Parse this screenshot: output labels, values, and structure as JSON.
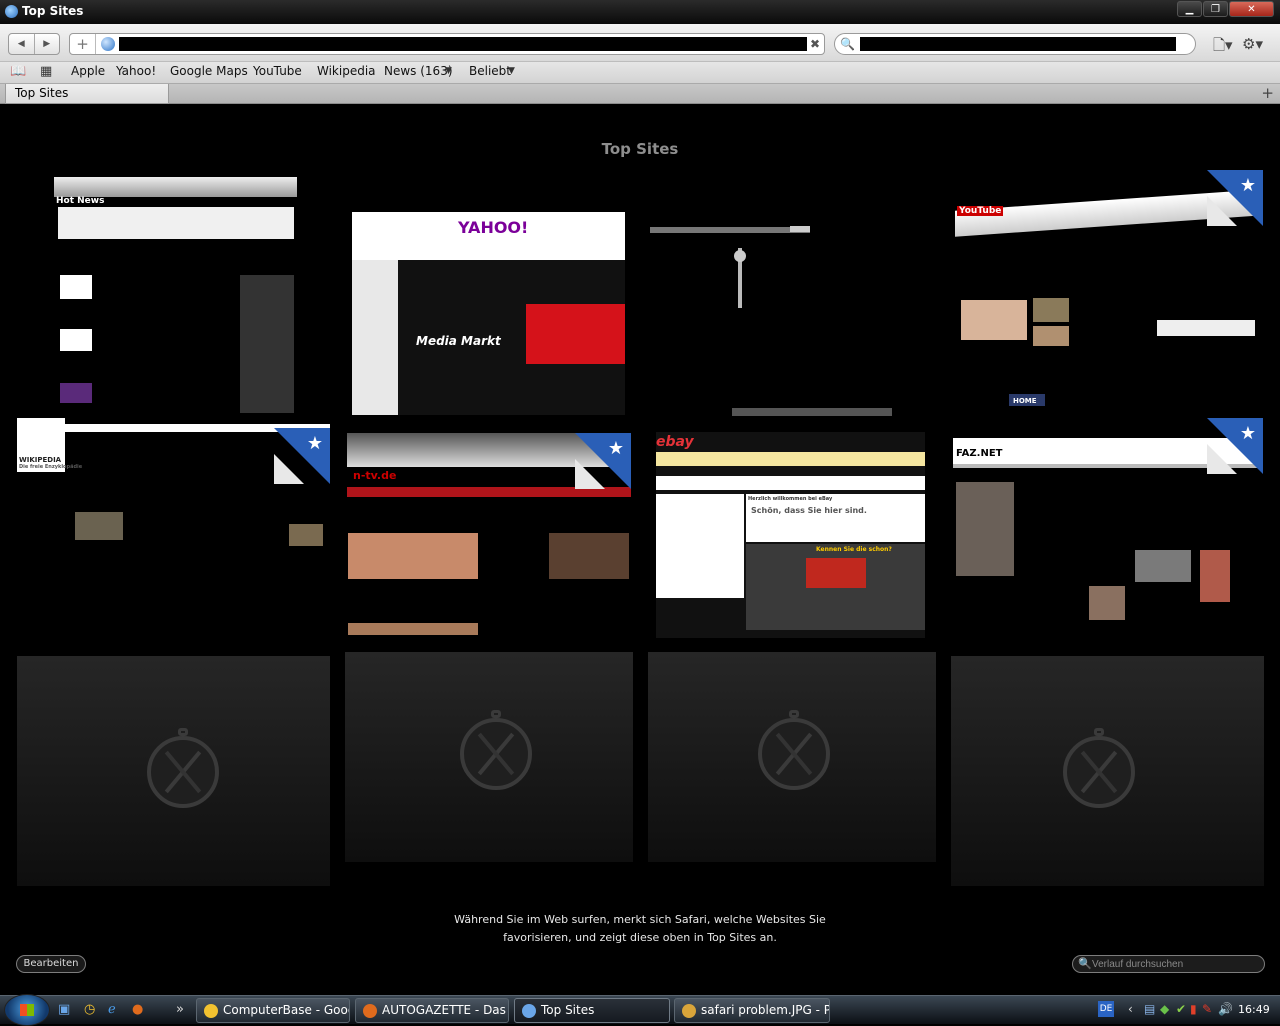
{
  "window": {
    "title": "Top Sites"
  },
  "toolbar": {
    "url": "",
    "search": ""
  },
  "bookmarks": [
    {
      "label": "Apple"
    },
    {
      "label": "Yahoo!"
    },
    {
      "label": "Google Maps"
    },
    {
      "label": "YouTube"
    },
    {
      "label": "Wikipedia"
    },
    {
      "label": "News (163)"
    },
    {
      "label": "Beliebt"
    }
  ],
  "tab": {
    "label": "Top Sites"
  },
  "page": {
    "title": "Top Sites",
    "info_line1": "Während Sie im Web surfen, merkt sich Safari, welche Websites Sie",
    "info_line2": "favorisieren, und zeigt diese oben in Top Sites an.",
    "edit_label": "Bearbeiten",
    "history_placeholder": "Verlauf durchsuchen"
  },
  "thumbs": {
    "apple_heading": "Hot News",
    "yahoo_logo": "YAHOO!",
    "media_markt": "Media Markt",
    "youtube_logo": "YouTube",
    "youtube_home": "HOME",
    "wiki_logo": "WIKIPEDIA",
    "wiki_sub": "Die freie Enzyklopädie",
    "ntv_logo": "n-tv.de",
    "ebay_logo": "ebay",
    "ebay_welcome": "Herzlich willkommen bei eBay",
    "ebay_search": "Schön, dass Sie hier sind.",
    "ebay_know": "Kennen Sie die schon?",
    "faz_logo": "FAZ.NET"
  },
  "taskbar": {
    "tasks": [
      {
        "label": "ComputerBase - Googl...",
        "color": "#f2c230"
      },
      {
        "label": "AUTOGAZETTE - Das ...",
        "color": "#e06b1d"
      },
      {
        "label": "Top Sites",
        "color": "#6aa6e8"
      },
      {
        "label": "safari problem.JPG - P...",
        "color": "#d9a53a"
      }
    ],
    "lang": "DE",
    "clock": "16:49"
  }
}
